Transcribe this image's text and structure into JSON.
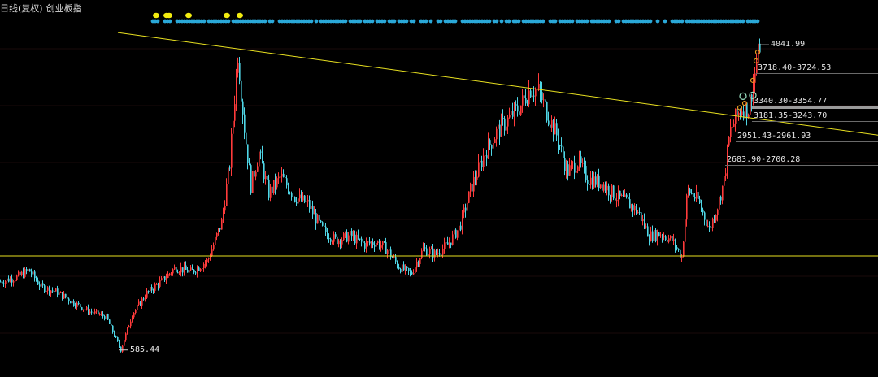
{
  "header": {
    "title": "日线(复权)",
    "subtitle": "创业板指"
  },
  "colors": {
    "up": "#ff3b3b",
    "down": "#4fd6e6",
    "trendline": "#e8e020",
    "signal_dot": "#2aa8d8",
    "yellow_dot": "#f2ec10",
    "orange_marker": "#e89a20",
    "level_line": "#6a6a6a"
  },
  "chart_data": {
    "type": "candlestick",
    "title": "日线(复权) 创业板指",
    "y_scale": "linear",
    "ylim": [
      500,
      4200
    ],
    "annotations": {
      "high": 4041.99,
      "low": 585.44
    },
    "price_levels": [
      {
        "label": "3718.40-3724.53",
        "low": 3718.4,
        "high": 3724.53
      },
      {
        "label": "3340.30-3354.77",
        "low": 3340.3,
        "high": 3354.77
      },
      {
        "label": "3181.35-3243.70",
        "low": 3181.35,
        "high": 3243.7
      },
      {
        "label": "2951.43-2961.93",
        "low": 2951.43,
        "high": 2961.93
      },
      {
        "label": "2683.90-2700.28",
        "low": 2683.9,
        "high": 2700.28
      }
    ],
    "horizontal_support": 1650,
    "trendline": {
      "from_price": 4180,
      "to_price": 3020
    },
    "price_path": [
      [
        0,
        1360
      ],
      [
        20,
        1410
      ],
      [
        35,
        1490
      ],
      [
        50,
        1300
      ],
      [
        70,
        1240
      ],
      [
        90,
        1120
      ],
      [
        110,
        1020
      ],
      [
        130,
        960
      ],
      [
        148,
        585
      ],
      [
        162,
        990
      ],
      [
        180,
        1230
      ],
      [
        200,
        1380
      ],
      [
        215,
        1520
      ],
      [
        235,
        1470
      ],
      [
        255,
        1600
      ],
      [
        272,
        2030
      ],
      [
        282,
        2700
      ],
      [
        292,
        3950
      ],
      [
        300,
        3100
      ],
      [
        308,
        2450
      ],
      [
        318,
        2820
      ],
      [
        330,
        2360
      ],
      [
        345,
        2550
      ],
      [
        362,
        2320
      ],
      [
        378,
        2240
      ],
      [
        395,
        1960
      ],
      [
        412,
        1830
      ],
      [
        430,
        1880
      ],
      [
        448,
        1780
      ],
      [
        462,
        1810
      ],
      [
        475,
        1730
      ],
      [
        490,
        1530
      ],
      [
        505,
        1440
      ],
      [
        520,
        1730
      ],
      [
        535,
        1670
      ],
      [
        550,
        1780
      ],
      [
        565,
        1980
      ],
      [
        580,
        2450
      ],
      [
        595,
        2800
      ],
      [
        610,
        3050
      ],
      [
        625,
        3200
      ],
      [
        640,
        3360
      ],
      [
        652,
        3550
      ],
      [
        662,
        3520
      ],
      [
        672,
        3280
      ],
      [
        685,
        3000
      ],
      [
        697,
        2600
      ],
      [
        710,
        2720
      ],
      [
        722,
        2530
      ],
      [
        740,
        2470
      ],
      [
        758,
        2320
      ],
      [
        772,
        2250
      ],
      [
        785,
        2140
      ],
      [
        798,
        1880
      ],
      [
        812,
        1900
      ],
      [
        826,
        1830
      ],
      [
        838,
        1640
      ],
      [
        845,
        2400
      ],
      [
        858,
        2280
      ],
      [
        872,
        1950
      ],
      [
        882,
        2220
      ],
      [
        890,
        2500
      ],
      [
        897,
        3050
      ],
      [
        905,
        3230
      ],
      [
        912,
        3330
      ],
      [
        920,
        3310
      ],
      [
        928,
        3720
      ],
      [
        934,
        4041.99
      ]
    ]
  }
}
